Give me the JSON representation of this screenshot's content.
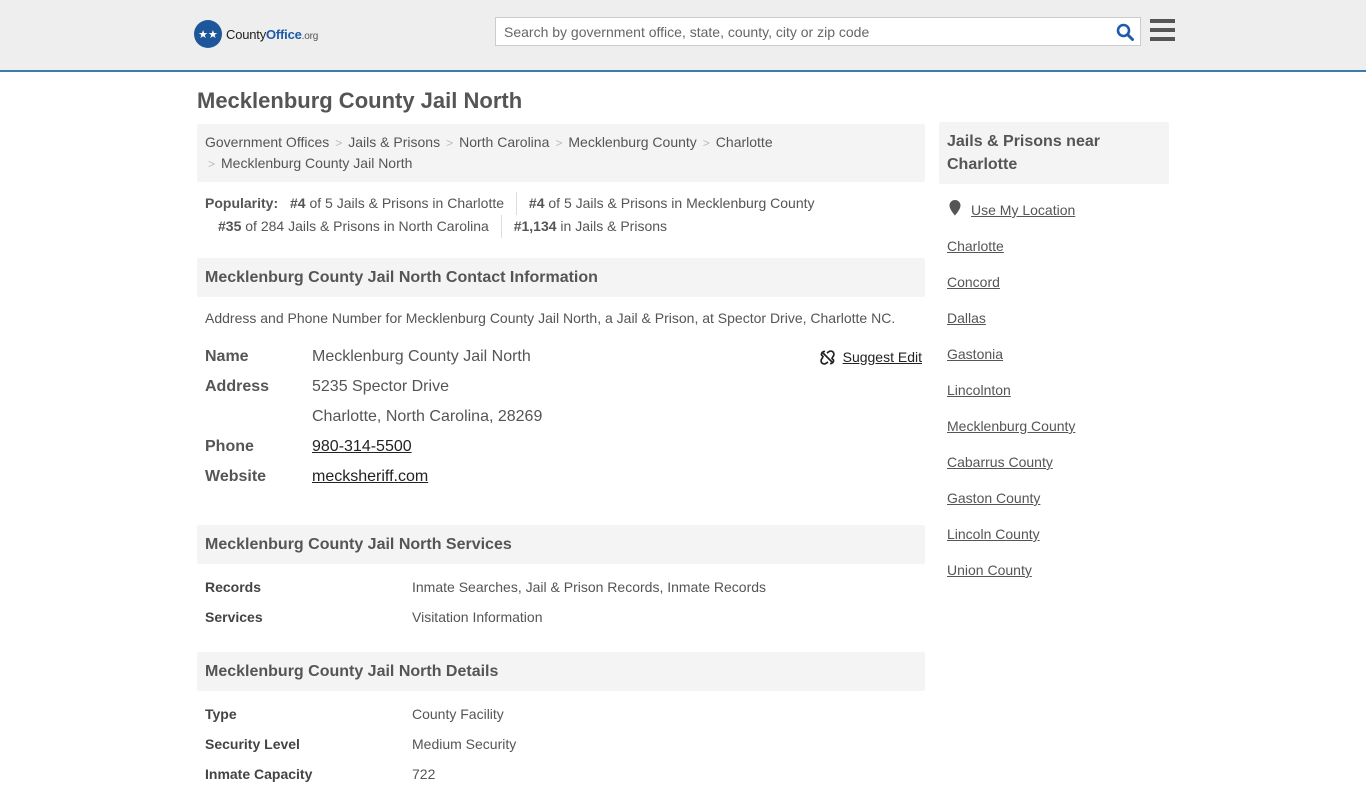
{
  "header": {
    "logo_text_county": "County",
    "logo_text_office": "Office",
    "logo_text_org": ".org",
    "search_placeholder": "Search by government office, state, county, city or zip code",
    "search_value": ""
  },
  "page_title": "Mecklenburg County Jail North",
  "breadcrumb": [
    "Government Offices",
    "Jails & Prisons",
    "North Carolina",
    "Mecklenburg County",
    "Charlotte",
    "Mecklenburg County Jail North"
  ],
  "popularity": {
    "label": "Popularity:",
    "items": [
      {
        "rank": "#4",
        "text": " of 5 Jails & Prisons in Charlotte"
      },
      {
        "rank": "#4",
        "text": " of 5 Jails & Prisons in Mecklenburg County"
      },
      {
        "rank": "#35",
        "text": " of 284 Jails & Prisons in North Carolina"
      },
      {
        "rank": "#1,134",
        "text": " in Jails & Prisons"
      }
    ]
  },
  "contact": {
    "heading": "Mecklenburg County Jail North Contact Information",
    "description": "Address and Phone Number for Mecklenburg County Jail North, a Jail & Prison, at Spector Drive, Charlotte NC.",
    "suggest_edit": "Suggest Edit",
    "rows": [
      {
        "key": "Name",
        "value": "Mecklenburg County Jail North"
      },
      {
        "key": "Address",
        "value": "5235 Spector Drive"
      },
      {
        "key": "",
        "value": "Charlotte, North Carolina, 28269"
      },
      {
        "key": "Phone",
        "value": "980-314-5500"
      },
      {
        "key": "Website",
        "value": "mecksheriff.com"
      }
    ]
  },
  "services": {
    "heading": "Mecklenburg County Jail North Services",
    "rows": [
      {
        "key": "Records",
        "value": "Inmate Searches, Jail & Prison Records, Inmate Records"
      },
      {
        "key": "Services",
        "value": "Visitation Information"
      }
    ]
  },
  "details": {
    "heading": "Mecklenburg County Jail North Details",
    "rows": [
      {
        "key": "Type",
        "value": "County Facility"
      },
      {
        "key": "Security Level",
        "value": "Medium Security"
      },
      {
        "key": "Inmate Capacity",
        "value": "722"
      }
    ]
  },
  "sidebar": {
    "heading": "Jails & Prisons near Charlotte",
    "use_location": "Use My Location",
    "links": [
      "Charlotte",
      "Concord",
      "Dallas",
      "Gastonia",
      "Lincolnton",
      "Mecklenburg County",
      "Cabarrus County",
      "Gaston County",
      "Lincoln County",
      "Union County"
    ]
  }
}
